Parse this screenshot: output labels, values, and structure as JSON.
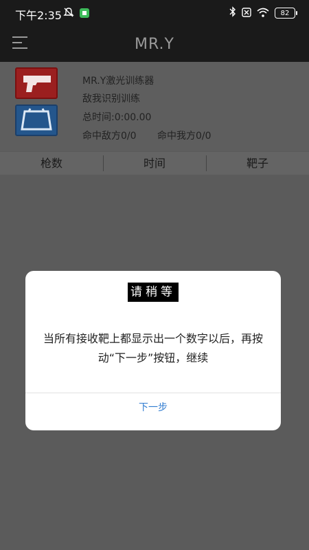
{
  "status_bar": {
    "time": "下午2:35",
    "battery": "82",
    "icons": [
      "silent-icon",
      "app-notification-icon",
      "bluetooth-icon",
      "sim-icon",
      "wifi-icon",
      "battery-icon"
    ]
  },
  "header": {
    "title": "MR.Y",
    "menu_icon": "hamburger-menu-icon"
  },
  "info": {
    "device_name": "MR.Y激光训练器",
    "mode": "敌我识别训练",
    "total_time": "总时间:0:00.00",
    "hit_enemy": "命中敌方0/0",
    "hit_friend": "命中我方0/0",
    "icons": [
      "pistol-icon",
      "target-icon"
    ]
  },
  "tabs": [
    {
      "label": "枪数"
    },
    {
      "label": "时间"
    },
    {
      "label": "靶子"
    }
  ],
  "dialog": {
    "title": "请稍等",
    "message": "当所有接收靶上都显示出一个数字以后，再按动“下一步”按钮，继续",
    "button": "下一步"
  },
  "colors": {
    "dialog_button": "#2f7bd0",
    "pistol_icon_bg": "#9b1f1f",
    "target_icon_bg": "#24568c"
  }
}
